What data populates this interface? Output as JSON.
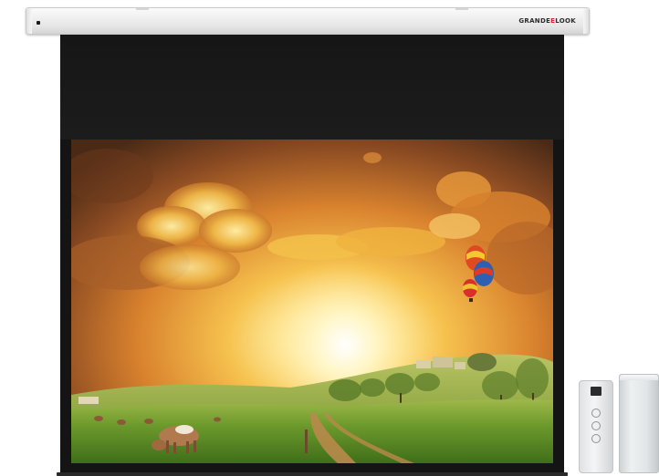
{
  "product": {
    "brand_text_main": "GRANDE",
    "brand_text_accent": "E",
    "brand_text_tail": "LOOK",
    "brand_accent_color": "#d9262a",
    "housing_color": "#e8e8e8",
    "screen_border_color": "#141414"
  },
  "projected_image": {
    "scene": "sunset-meadow",
    "elements": [
      "sun",
      "clouds",
      "hot-air-balloons",
      "cow",
      "dirt-path",
      "trees",
      "hill-village"
    ]
  },
  "accessories": {
    "remote": {
      "buttons": [
        "up",
        "stop",
        "down"
      ],
      "icon": "remote-control-icon"
    },
    "receiver": {
      "icon": "receiver-box-icon"
    }
  }
}
